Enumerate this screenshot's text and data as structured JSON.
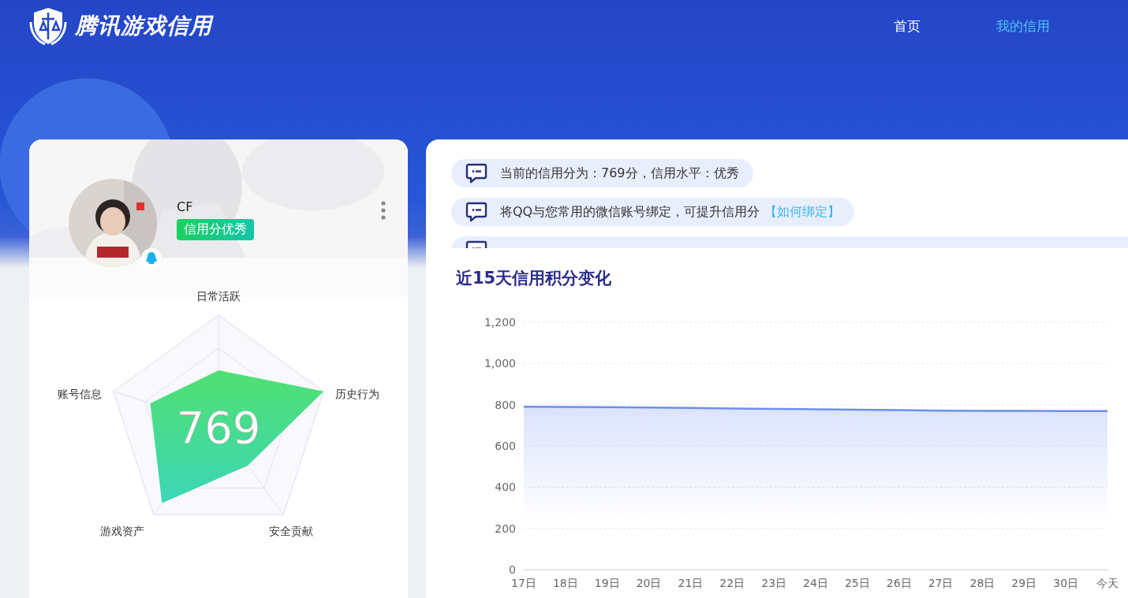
{
  "header": {
    "logo_text": "腾讯游戏信用",
    "nav": [
      {
        "label": "首页",
        "selected": false
      },
      {
        "label": "我的信用",
        "selected": true
      }
    ]
  },
  "profile": {
    "name": "CF",
    "badge": "信用分优秀",
    "score": "769",
    "radar_labels": [
      "日常活跃",
      "历史行为",
      "安全贡献",
      "游戏资产",
      "账号信息"
    ]
  },
  "notices": [
    {
      "text": "当前的信用分为：769分，信用水平：优秀"
    },
    {
      "text": "将QQ与您常用的微信账号绑定，可提升信用分",
      "link": "【如何绑定】"
    }
  ],
  "chart": {
    "title": "近15天信用积分变化",
    "chart_data": {
      "type": "area",
      "categories": [
        "17日",
        "18日",
        "19日",
        "20日",
        "21日",
        "22日",
        "23日",
        "24日",
        "25日",
        "26日",
        "27日",
        "28日",
        "29日",
        "30日",
        "今天"
      ],
      "series": [
        {
          "color": "#6e8ff0",
          "values": [
            790,
            789,
            788,
            786,
            784,
            782,
            780,
            778,
            776,
            774,
            771,
            770,
            770,
            769,
            769
          ]
        }
      ],
      "grid": true,
      "ylim": [
        0,
        1200
      ],
      "yticks": [
        0,
        200,
        400,
        600,
        800,
        {
          "value": 1000,
          "label": "1,000"
        },
        {
          "value": 1200,
          "label": "1,200"
        }
      ]
    }
  }
}
